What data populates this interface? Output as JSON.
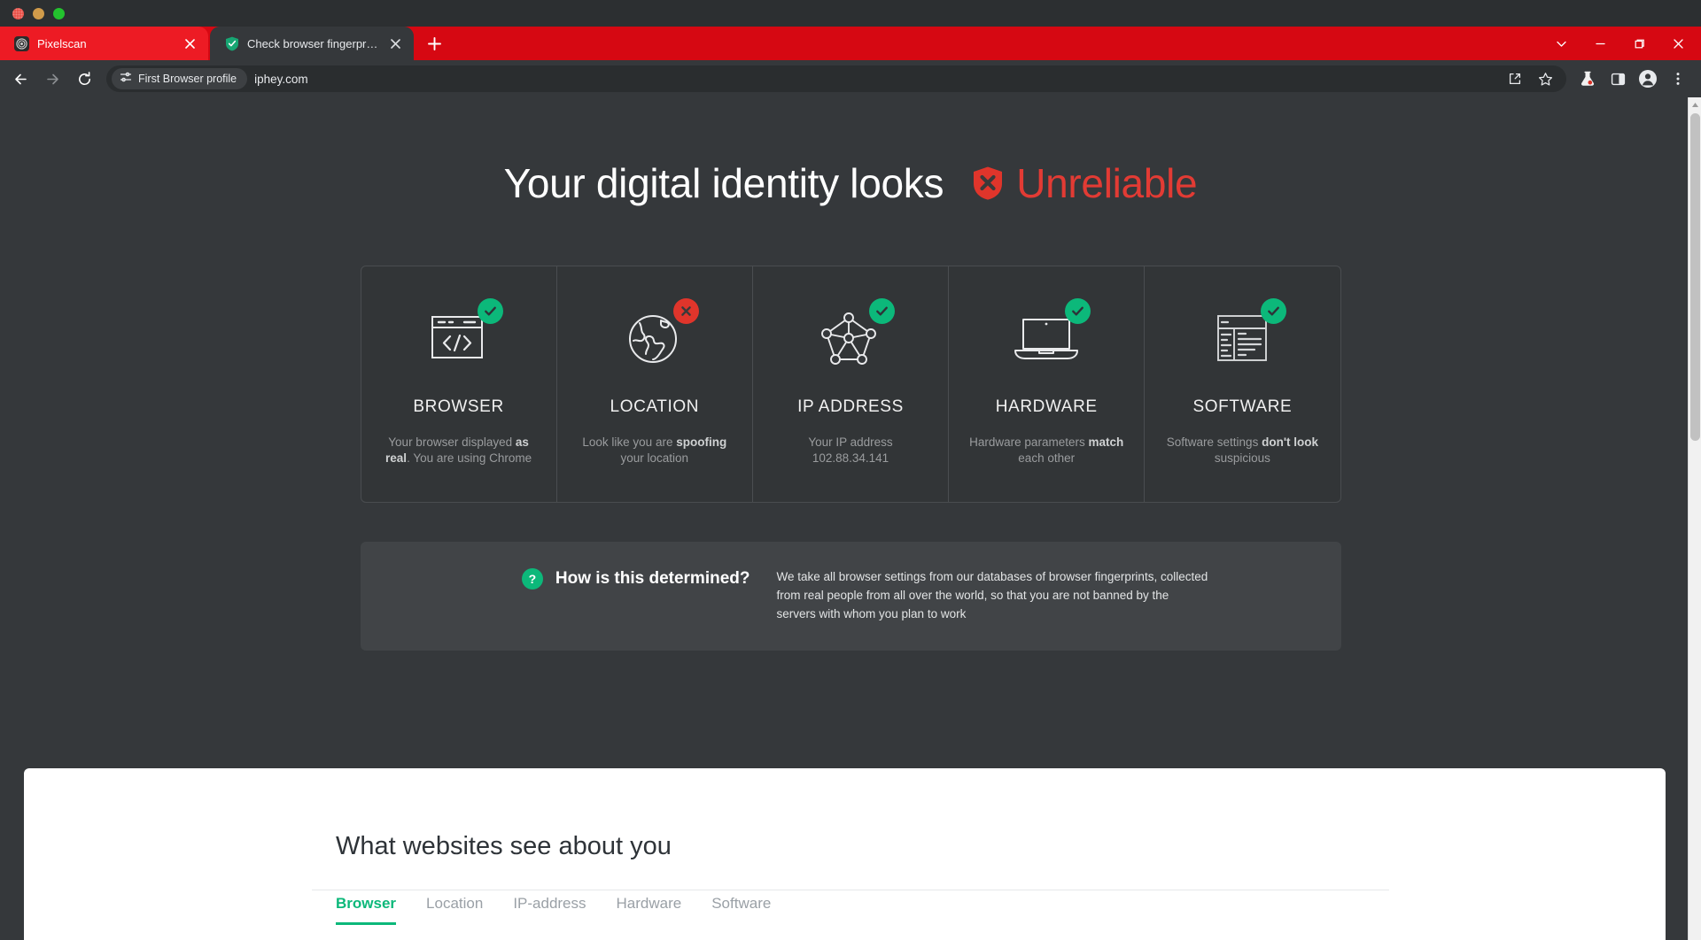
{
  "browser": {
    "window_dots": [
      "close",
      "minimize",
      "zoom"
    ],
    "tabs": [
      {
        "title": "Pixelscan",
        "favicon": "pixelscan-icon",
        "active": false,
        "close_label": "×"
      },
      {
        "title": "Check browser fingerprints",
        "favicon": "green-shield-icon",
        "active": true,
        "close_label": "×"
      }
    ],
    "new_tab_label": "+",
    "window_controls": [
      "chevron-down",
      "minimize",
      "maximize",
      "close"
    ],
    "toolbar": {
      "back": "←",
      "forward": "→",
      "reload": "⟳",
      "profile_pill": "First Browser profile",
      "url": "iphey.com",
      "right_icons": [
        "share-icon",
        "bookmark-star-icon",
        "flask-icon",
        "side-panel-icon",
        "profile-avatar-icon",
        "three-dot-menu-icon"
      ]
    }
  },
  "page": {
    "hero": {
      "text": "Your digital identity looks",
      "status": "Unreliable",
      "status_color": "#e23b34",
      "shield_icon": "shield-x-icon"
    },
    "cards": [
      {
        "id": "browser",
        "title": "BROWSER",
        "icon": "browser-window-code-icon",
        "status": "ok",
        "desc_parts": [
          {
            "text": "Your browser displayed ",
            "bold": false
          },
          {
            "text": "as real",
            "bold": true
          },
          {
            "text": ". You are using Chrome",
            "bold": false
          }
        ]
      },
      {
        "id": "location",
        "title": "LOCATION",
        "icon": "globe-icon",
        "status": "bad",
        "desc_parts": [
          {
            "text": "Look like you are ",
            "bold": false
          },
          {
            "text": "spoofing",
            "bold": true
          },
          {
            "text": " your location",
            "bold": false
          }
        ]
      },
      {
        "id": "ip-address",
        "title": "IP ADDRESS",
        "icon": "network-nodes-icon",
        "status": "ok",
        "desc_parts": [
          {
            "text": "Your IP address 102.88.34.141",
            "bold": false
          }
        ]
      },
      {
        "id": "hardware",
        "title": "HARDWARE",
        "icon": "laptop-icon",
        "status": "ok",
        "desc_parts": [
          {
            "text": "Hardware parameters ",
            "bold": false
          },
          {
            "text": "match",
            "bold": true
          },
          {
            "text": " each other",
            "bold": false
          }
        ]
      },
      {
        "id": "software",
        "title": "SOFTWARE",
        "icon": "dashboard-panels-icon",
        "status": "ok",
        "desc_parts": [
          {
            "text": "Software settings ",
            "bold": false
          },
          {
            "text": "don't look",
            "bold": true
          },
          {
            "text": " suspicious",
            "bold": false
          }
        ]
      }
    ],
    "info_box": {
      "icon": "question-mark-icon",
      "title": "How is this determined?",
      "body": "We take all browser settings from our databases of browser fingerprints, collected from real people from all over the world, so that you are not banned by the servers with whom you plan to work"
    },
    "lower_panel": {
      "title": "What websites see about you",
      "tabs": [
        {
          "label": "Browser",
          "active": true
        },
        {
          "label": "Location",
          "active": false
        },
        {
          "label": "IP-address",
          "active": false
        },
        {
          "label": "Hardware",
          "active": false
        },
        {
          "label": "Software",
          "active": false
        }
      ]
    }
  },
  "colors": {
    "accent_green": "#0cb87a",
    "danger_red": "#e0352b",
    "tabstrip_red": "#d60812",
    "page_bg": "#35383b"
  }
}
